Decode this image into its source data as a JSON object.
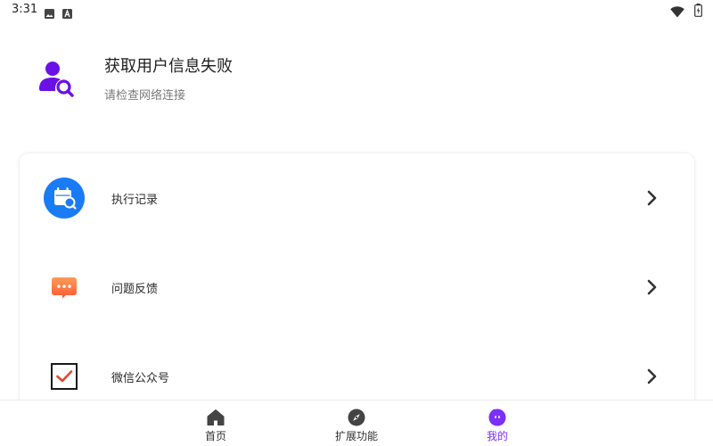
{
  "status_bar": {
    "time": "3:31",
    "icons": [
      "image-icon",
      "a-icon",
      "wifi-icon",
      "battery-icon"
    ]
  },
  "profile": {
    "title": "获取用户信息失败",
    "subtitle": "请检查网络连接",
    "icon": "user-search-icon",
    "accent": "#6a11e6"
  },
  "menu": {
    "items": [
      {
        "label": "执行记录",
        "icon": "calendar-search-icon",
        "color": "#1a7cf5"
      },
      {
        "label": "问题反馈",
        "icon": "chat-bubble-icon",
        "color": "#ff6a3a"
      },
      {
        "label": "微信公众号",
        "icon": "wechat-official-icon",
        "color": "#ea5a3a"
      }
    ]
  },
  "bottom_nav": {
    "items": [
      {
        "label": "首页",
        "icon": "home-icon",
        "active": false
      },
      {
        "label": "扩展功能",
        "icon": "compass-icon",
        "active": false
      },
      {
        "label": "我的",
        "icon": "profile-face-icon",
        "active": true
      }
    ],
    "active_color": "#7b2ff7"
  }
}
